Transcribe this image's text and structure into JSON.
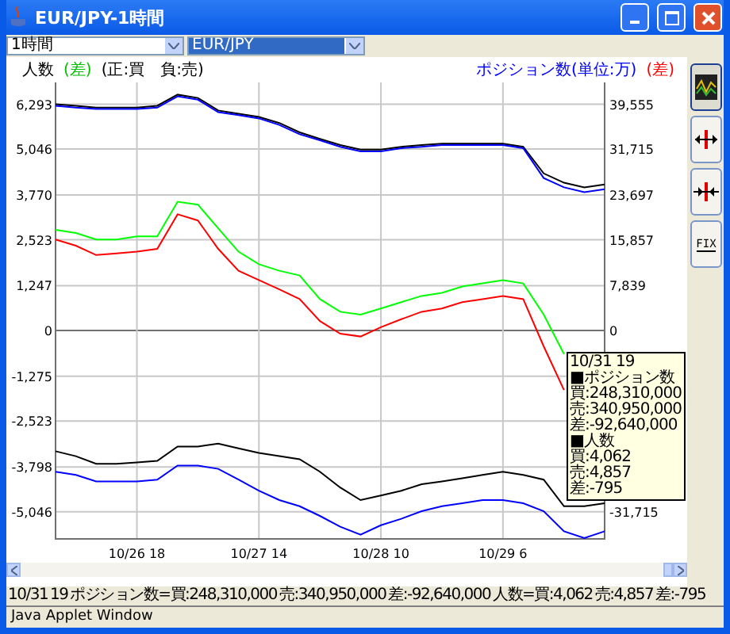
{
  "window": {
    "title": "EUR/JPY-1時間"
  },
  "toolbar": {
    "combos": [
      {
        "value": "1時間",
        "highlighted": false
      },
      {
        "value": "EUR/JPY",
        "highlighted": true
      }
    ]
  },
  "legend": {
    "left_label": "人数",
    "left_diff": "(差)",
    "sign_note": "(正:買　負:売)",
    "right_label": "ポジション数(単位:万)",
    "right_diff": "(差)"
  },
  "chart_data": {
    "type": "line",
    "categories": [
      null,
      null,
      null,
      null,
      "10/26 18",
      null,
      null,
      null,
      null,
      null,
      "10/27 14",
      null,
      null,
      null,
      null,
      null,
      "10/28 10",
      null,
      null,
      null,
      null,
      null,
      "10/29 6",
      null,
      null,
      null,
      null,
      null
    ],
    "ylim": [
      -5800,
      6900
    ],
    "yticks": [
      {
        "value": 6293,
        "label": "6,293"
      },
      {
        "value": 5046,
        "label": "5,046"
      },
      {
        "value": 3770,
        "label": "3,770"
      },
      {
        "value": 2523,
        "label": "2,523"
      },
      {
        "value": 1247,
        "label": "1,247"
      },
      {
        "value": 0,
        "label": "0"
      },
      {
        "value": -1275,
        "label": "-1,275"
      },
      {
        "value": -2523,
        "label": "-2,523"
      },
      {
        "value": -3798,
        "label": "-3,798"
      },
      {
        "value": -5046,
        "label": "-5,046"
      }
    ],
    "grid": true,
    "series": [
      {
        "color": "#000000",
        "values": [
          6290,
          6250,
          6200,
          6200,
          6200,
          6250,
          6560,
          6470,
          6120,
          6030,
          5940,
          5770,
          5510,
          5330,
          5160,
          5030,
          5030,
          5110,
          5160,
          5200,
          5200,
          5200,
          5200,
          5110,
          4370,
          4110,
          3980,
          4060
        ]
      },
      {
        "color": "#0000ff",
        "values": [
          6250,
          6200,
          6160,
          6160,
          6160,
          6200,
          6510,
          6420,
          6070,
          5990,
          5900,
          5720,
          5460,
          5290,
          5110,
          4980,
          4980,
          5070,
          5110,
          5160,
          5160,
          5160,
          5160,
          5070,
          4240,
          3980,
          3850,
          3930
        ]
      },
      {
        "color": "#00ff00",
        "values": [
          2800,
          2710,
          2530,
          2530,
          2620,
          2620,
          3580,
          3500,
          2840,
          2190,
          1840,
          1660,
          1530,
          870,
          520,
          440,
          610,
          790,
          960,
          1050,
          1220,
          1310,
          1400,
          1310,
          440,
          -660,
          null,
          null
        ]
      },
      {
        "color": "#ff0000",
        "values": [
          2530,
          2360,
          2100,
          2140,
          2190,
          2270,
          3230,
          3060,
          2270,
          1660,
          1400,
          1140,
          870,
          260,
          -90,
          -170,
          90,
          310,
          520,
          610,
          790,
          870,
          960,
          870,
          -440,
          -1660,
          null,
          null
        ]
      },
      {
        "color": "#000000",
        "values": [
          -3360,
          -3500,
          -3710,
          -3710,
          -3670,
          -3630,
          -3230,
          -3230,
          -3150,
          -3280,
          -3410,
          -3500,
          -3580,
          -3930,
          -4370,
          -4720,
          -4590,
          -4460,
          -4280,
          -4200,
          -4110,
          -4020,
          -3930,
          -4020,
          -4150,
          -4890,
          -4890,
          -4810
        ]
      },
      {
        "color": "#0000ff",
        "values": [
          -3930,
          -4020,
          -4200,
          -4200,
          -4200,
          -4150,
          -3760,
          -3760,
          -3850,
          -4150,
          -4460,
          -4720,
          -4890,
          -5160,
          -5460,
          -5680,
          -5420,
          -5240,
          -5030,
          -4890,
          -4810,
          -4720,
          -4720,
          -4810,
          -5030,
          -5590,
          -5780,
          -5590
        ]
      }
    ]
  },
  "right_axis": [
    {
      "label": "39,555",
      "covered": false
    },
    {
      "label": "31,715",
      "covered": false
    },
    {
      "label": "23,697",
      "covered": false
    },
    {
      "label": "15,857",
      "covered": false
    },
    {
      "label": "7,839",
      "covered": false
    },
    {
      "label": "0",
      "covered": false
    },
    {
      "covered": true
    },
    {
      "covered": true
    },
    {
      "covered": true
    },
    {
      "label": "-31,715",
      "covered": false
    }
  ],
  "tooltip": {
    "lines": [
      "10/31 19",
      "■ポジション数",
      "買:248,310,000",
      "売:340,950,000",
      "差:-92,640,000",
      "■人数",
      "買:4,062",
      "売:4,857",
      "差:-795"
    ]
  },
  "sidebar": {
    "buttons": [
      {
        "kind": "chart",
        "pressed": true
      },
      {
        "kind": "expand",
        "pressed": false
      },
      {
        "kind": "shrink",
        "pressed": false
      },
      {
        "kind": "fix",
        "pressed": false,
        "label": "FIX"
      }
    ]
  },
  "status_line": "10/31 19  ポジション数=買:248,310,000 売:340,950,000 差:-92,640,000 人数=買:4,062 売:4,857 差:-795",
  "footer": "Java Applet Window"
}
